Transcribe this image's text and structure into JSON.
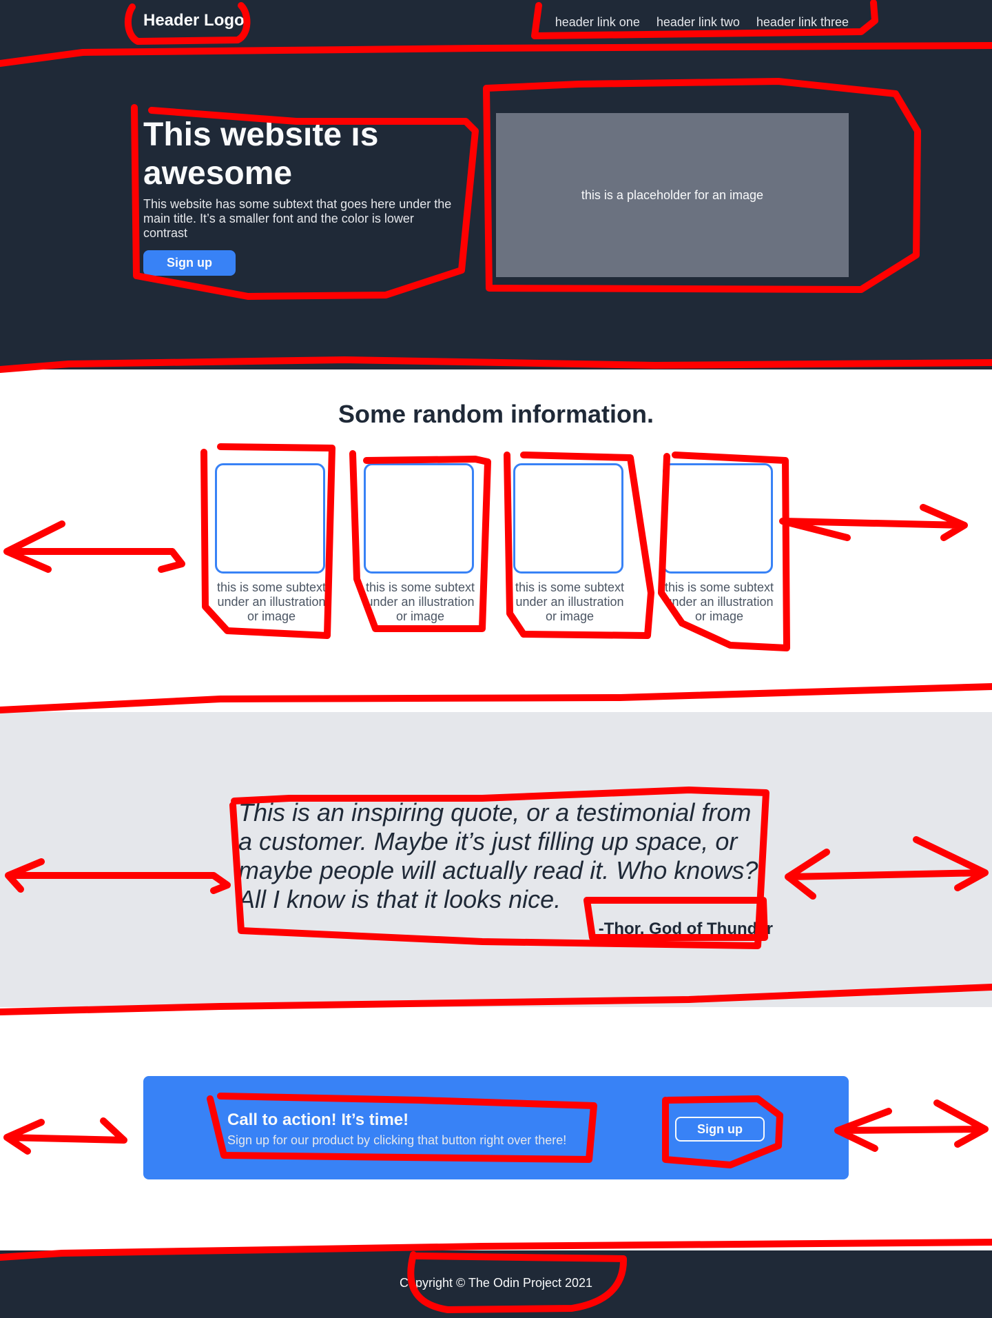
{
  "header": {
    "logo": "Header Logo",
    "links": [
      "header link one",
      "header link two",
      "header link three"
    ]
  },
  "hero": {
    "title": "This website is awesome",
    "subtext": "This website has some subtext that goes here under the main title.  It’s a smaller font and the color is lower contrast",
    "button_label": "Sign up",
    "image_placeholder": "this is a placeholder for an image"
  },
  "info": {
    "title": "Some random information.",
    "cards": [
      {
        "text": "this is some subtext under an illustration or image"
      },
      {
        "text": "this is some subtext under an illustration or image"
      },
      {
        "text": "this is some subtext under an illustration or image"
      },
      {
        "text": "this is some subtext under an illustration or image"
      }
    ]
  },
  "quote": {
    "text": "This is an inspiring quote, or a testimonial from a customer.  Maybe it’s just filling up space, or maybe people will actually read it. Who knows?  All I know is that it looks nice.",
    "author": "-Thor, God of Thunder"
  },
  "cta": {
    "title": "Call to action! It’s time!",
    "subtext": "Sign up for our product by clicking that button right over there!",
    "button_label": "Sign up"
  },
  "footer": {
    "copyright": "Copyright  ©  The Odin Project 2021"
  },
  "colors": {
    "dark": "#1f2937",
    "blue": "#3882f6",
    "light_gray": "#e5e7eb",
    "placeholder_gray": "#6b7280",
    "annotation_red": "#ff0000"
  }
}
